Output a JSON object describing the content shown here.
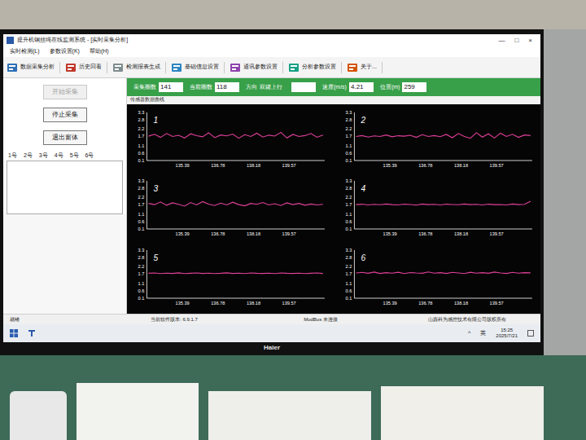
{
  "window": {
    "title": "提升机钢丝绳在线监测系统 - [实时采集分析]",
    "controls": [
      "—",
      "□",
      "×"
    ]
  },
  "menu": [
    "实时检测(L)",
    "参数设置(K)",
    "帮助(H)"
  ],
  "toolbar": [
    "数据采集分析",
    "历史回看",
    "检测报表生成",
    "基础信息设置",
    "通讯参数设置",
    "分析参数设置",
    "关于..."
  ],
  "left_panel": {
    "buttons": [
      {
        "label": "开始采集",
        "disabled": true
      },
      {
        "label": "停止采集",
        "disabled": false
      },
      {
        "label": "退出窗体",
        "disabled": false
      }
    ],
    "tabs": [
      {
        "label": "1号",
        "selected": false
      },
      {
        "label": "2号",
        "selected": false
      },
      {
        "label": "3号",
        "selected": false
      },
      {
        "label": "4号",
        "selected": false
      },
      {
        "label": "5号",
        "selected": false
      },
      {
        "label": "6号",
        "selected": false
      }
    ]
  },
  "info_bar": [
    {
      "label": "采集圈数",
      "value": "141",
      "kind": "box"
    },
    {
      "label": "当前圈数",
      "value": "118",
      "kind": "box"
    },
    {
      "label": "方向",
      "value": "双罐上行",
      "kind": "plain"
    },
    {
      "label": "",
      "value": "",
      "kind": "box"
    },
    {
      "label": "速度(m/s)",
      "value": "4.21",
      "kind": "box"
    },
    {
      "label": "位置(m)",
      "value": "259",
      "kind": "box"
    }
  ],
  "chart_panel": {
    "title": "传感器数据曲线",
    "y_ticks": [
      "3.3",
      "2.8",
      "2.2",
      "1.7",
      "1.1",
      "0.6",
      "0.1"
    ],
    "x_ticks": [
      "135.39",
      "136.78",
      "138.18",
      "139.57"
    ],
    "charts": [
      {
        "label": "1",
        "color": "#e0409a",
        "values": [
          1.72,
          1.85,
          1.64,
          1.9,
          1.7,
          1.78,
          1.6,
          1.88,
          1.75,
          1.68,
          1.95,
          1.62,
          1.8,
          1.74,
          1.86,
          1.58,
          1.82,
          1.7,
          1.92,
          1.66,
          1.79,
          1.73,
          1.98,
          1.6,
          1.84,
          1.7,
          1.76,
          1.9,
          1.65,
          1.8
        ]
      },
      {
        "label": "2",
        "color": "#e0409a",
        "values": [
          1.7,
          1.76,
          1.66,
          1.74,
          1.7,
          1.8,
          1.68,
          1.75,
          1.72,
          1.78,
          1.64,
          1.82,
          1.7,
          1.76,
          1.69,
          1.84,
          1.62,
          1.9,
          1.7,
          1.58,
          1.95,
          1.66,
          1.88,
          1.6,
          1.92,
          1.7,
          1.85,
          1.64,
          1.8,
          1.76
        ]
      },
      {
        "label": "3",
        "color": "#e0409a",
        "values": [
          1.8,
          1.72,
          1.9,
          1.68,
          1.84,
          1.74,
          1.62,
          1.86,
          1.7,
          1.92,
          1.75,
          1.66,
          1.82,
          1.7,
          1.88,
          1.72,
          1.64,
          1.8,
          1.74,
          1.86,
          1.7,
          1.78,
          1.66,
          1.84,
          1.72,
          1.8,
          1.68,
          1.76,
          1.7,
          1.74
        ]
      },
      {
        "label": "4",
        "color": "#e0409a",
        "values": [
          1.72,
          1.75,
          1.7,
          1.74,
          1.71,
          1.76,
          1.72,
          1.7,
          1.75,
          1.73,
          1.69,
          1.76,
          1.72,
          1.74,
          1.7,
          1.75,
          1.73,
          1.71,
          1.76,
          1.72,
          1.74,
          1.7,
          1.75,
          1.72,
          1.73,
          1.7,
          1.76,
          1.72,
          1.74,
          1.95
        ]
      },
      {
        "label": "5",
        "color": "#e0409a",
        "values": [
          1.76,
          1.78,
          1.74,
          1.77,
          1.75,
          1.79,
          1.74,
          1.76,
          1.78,
          1.75,
          1.77,
          1.74,
          1.76,
          1.79,
          1.75,
          1.77,
          1.74,
          1.78,
          1.76,
          1.75,
          1.77,
          1.74,
          1.78,
          1.76,
          1.75,
          1.77,
          1.74,
          1.76,
          1.78,
          1.75
        ]
      },
      {
        "label": "6",
        "color": "#e0409a",
        "values": [
          1.78,
          1.82,
          1.76,
          1.84,
          1.75,
          1.8,
          1.77,
          1.83,
          1.74,
          1.81,
          1.78,
          1.76,
          1.85,
          1.77,
          1.8,
          1.75,
          1.82,
          1.78,
          1.74,
          1.83,
          1.77,
          1.8,
          1.76,
          1.84,
          1.78,
          1.75,
          1.82,
          1.77,
          1.8,
          1.79
        ]
      }
    ]
  },
  "status_bar": [
    "就绪",
    "当前软件版本: 6.9.1.7",
    "ModBus 未连接",
    "山西科为感控技术有限公司版权所有"
  ],
  "taskbar": {
    "tray": [
      "^",
      "英"
    ],
    "time": "15:25",
    "date": "2025/7/21"
  },
  "monitor": {
    "brand": "Haier"
  }
}
